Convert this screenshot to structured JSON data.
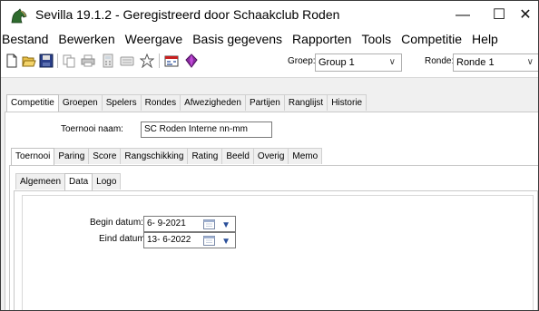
{
  "window": {
    "title": "Sevilla 19.1.2 - Geregistreerd door Schaakclub Roden",
    "controls": {
      "minimize": "—",
      "maximize": "☐",
      "close": "✕"
    }
  },
  "menu": [
    "Bestand",
    "Bewerken",
    "Weergave",
    "Basis gegevens",
    "Rapporten",
    "Tools",
    "Competitie",
    "Help"
  ],
  "toolbar": {
    "icons": [
      "new-icon",
      "open-icon",
      "save-icon",
      "copy-icon",
      "print-icon",
      "calculator-icon",
      "keyboard-icon",
      "pairing-icon",
      "tournament-icon",
      "gem-icon"
    ],
    "group_label": "Groep:",
    "group_value": "Group 1",
    "round_label": "Ronde:",
    "round_value": "Ronde 1"
  },
  "main_tabs": [
    "Competitie",
    "Groepen",
    "Spelers",
    "Rondes",
    "Afwezigheden",
    "Partijen",
    "Ranglijst",
    "Historie"
  ],
  "tournament": {
    "name_label": "Toernooi naam:",
    "name_value": "SC Roden Interne nn-mm"
  },
  "sub_tabs": [
    "Toernooi",
    "Paring",
    "Score",
    "Rangschikking",
    "Rating",
    "Beeld",
    "Overig",
    "Memo"
  ],
  "inner_tabs": [
    "Algemeen",
    "Data",
    "Logo"
  ],
  "dates": {
    "begin_label": "Begin datum:",
    "begin_value": "6- 9-2021",
    "end_label": "Eind datum:",
    "end_value": "13- 6-2022"
  },
  "colors": {
    "accent": "#2a4f9a",
    "horse": "#2e6b2e"
  }
}
